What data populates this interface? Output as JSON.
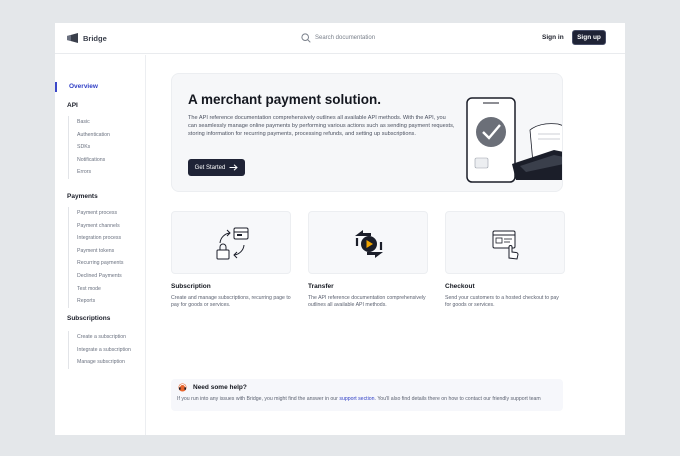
{
  "app": {
    "brand": "Bridge"
  },
  "search": {
    "placeholder": "Search documentation"
  },
  "header": {
    "sign_in": "Sign in",
    "sign_up": "Sign up"
  },
  "sidebar": {
    "overview": "Overview",
    "sections": [
      {
        "title": "API",
        "items": [
          "Basic",
          "Authentication",
          "SDKs",
          "Notifications",
          "Errors"
        ]
      },
      {
        "title": "Payments",
        "items": [
          "Payment process",
          "Payment channels",
          "Integration process",
          "Payment tokens",
          "Recurring payments",
          "Declined Payments",
          "Test mode",
          "Reports"
        ]
      },
      {
        "title": "Subscriptions",
        "items": [
          "Create a subscription",
          "Integrate a subscription",
          "Manage subscription"
        ]
      }
    ]
  },
  "hero": {
    "title": "A merchant payment solution.",
    "description": "The API reference documentation comprehensively outlines all available API methods. With the API, you can seamlessly manage online payments by performing various actions such as sending payment requests, storing information for recurring payments, processing refunds, and setting up subscriptions.",
    "cta": "Get Started",
    "cta_icon": "arrow-right-icon",
    "illustration_icon": "phone-payment-terminal-icon"
  },
  "cards": [
    {
      "title": "Subscription",
      "description": "Create and manage subscriptions, recurring page to pay for goods or services.",
      "icon": "subscription-icon"
    },
    {
      "title": "Transfer",
      "description": "The API reference documentation comprehensively outlines all available API methods.",
      "icon": "transfer-icon"
    },
    {
      "title": "Checkout",
      "description": "Send your customers to a hosted checkout to pay for goods or services.",
      "icon": "checkout-icon"
    }
  ],
  "help": {
    "title": "Need some help?",
    "text_before": "If you run into any issues with Bridge, you might find the answer in our ",
    "link": "support section",
    "text_after": ". You'll also find details there on how to contact our friendly support team"
  },
  "colors": {
    "accent": "#3140c6",
    "dark": "#1f2336",
    "background": "#e4e7ea"
  }
}
